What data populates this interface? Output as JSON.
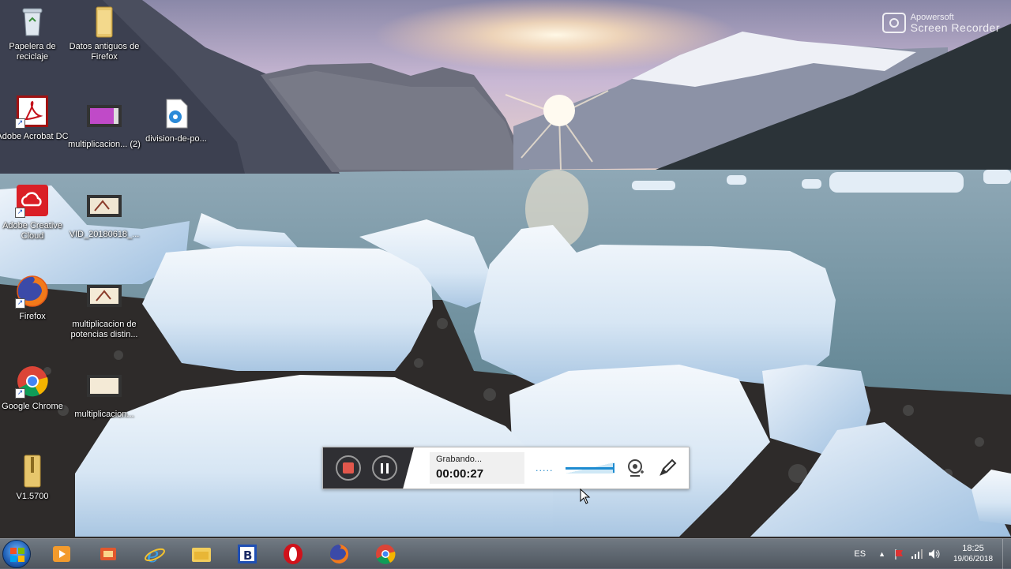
{
  "desktop_icons": [
    {
      "label": "Papelera de reciclaje",
      "icon": "recycle-bin-icon"
    },
    {
      "label": "Datos antiguos de Firefox",
      "icon": "folder-icon"
    },
    {
      "label": "Adobe Acrobat DC",
      "icon": "adobe-acrobat-icon"
    },
    {
      "label": "multiplicacion... (2)",
      "icon": "video-file-icon"
    },
    {
      "label": "division-de-po...",
      "icon": "audio-file-icon"
    },
    {
      "label": "Adobe Creative Cloud",
      "icon": "adobe-creative-cloud-icon"
    },
    {
      "label": "VID_20180618_...",
      "icon": "video-file-icon"
    },
    {
      "label": "Firefox",
      "icon": "firefox-icon"
    },
    {
      "label": "multiplicacion de potencias distin...",
      "icon": "video-file-icon"
    },
    {
      "label": "Google Chrome",
      "icon": "chrome-icon"
    },
    {
      "label": "multiplicacion...",
      "icon": "video-file-icon"
    },
    {
      "label": "V1.5700",
      "icon": "zip-folder-icon"
    }
  ],
  "watermark": {
    "line1": "Apowersoft",
    "line2": "Screen Recorder"
  },
  "recorder": {
    "status": "Grabando...",
    "time": "00:00:27",
    "dots": ".....",
    "volume_level": 1.0,
    "accent": "#1d8bd0",
    "stop_color": "#e2574c"
  },
  "taskbar": {
    "pinned": [
      "media-player-icon",
      "media-center-icon",
      "internet-explorer-icon",
      "file-explorer-icon",
      "b-app-icon",
      "opera-icon",
      "firefox-icon",
      "chrome-icon"
    ],
    "language": "ES",
    "time": "18:25",
    "date": "19/06/2018"
  }
}
